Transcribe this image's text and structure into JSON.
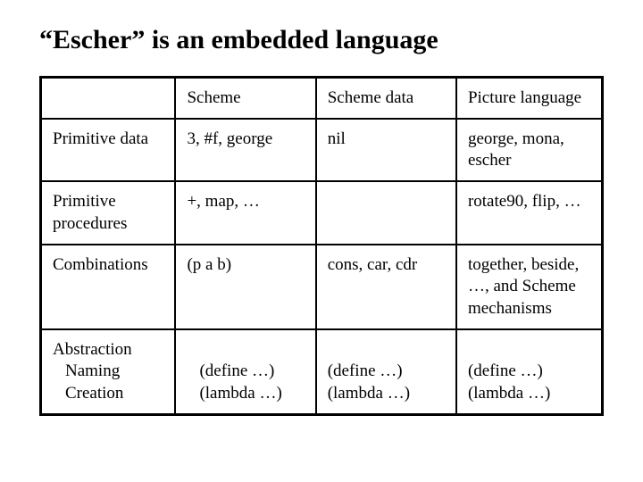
{
  "title": "“Escher” is an embedded language",
  "table": {
    "header": {
      "rowlabel": "",
      "col1": "Scheme",
      "col2": "Scheme data",
      "col3": "Picture language"
    },
    "rows": [
      {
        "label": "Primitive data",
        "col1": "3, #f, george",
        "col2": "nil",
        "col3": "george, mona, escher"
      },
      {
        "label": "Primitive procedures",
        "col1": "+, map, …",
        "col2": "",
        "col3": "rotate90, flip, …"
      },
      {
        "label": "Combinations",
        "col1": "(p a b)",
        "col2": "cons, car, cdr",
        "col3": "together, beside, …,\nand Scheme mechanisms"
      },
      {
        "label_main": "Abstraction",
        "label_sub1": "Naming",
        "label_sub2": "Creation",
        "col1_l1": "(define …)",
        "col1_l2": "(lambda …)",
        "col2_l1": "(define …)",
        "col2_l2": "(lambda …)",
        "col3_l1": "(define …)",
        "col3_l2": "(lambda …)"
      }
    ]
  }
}
